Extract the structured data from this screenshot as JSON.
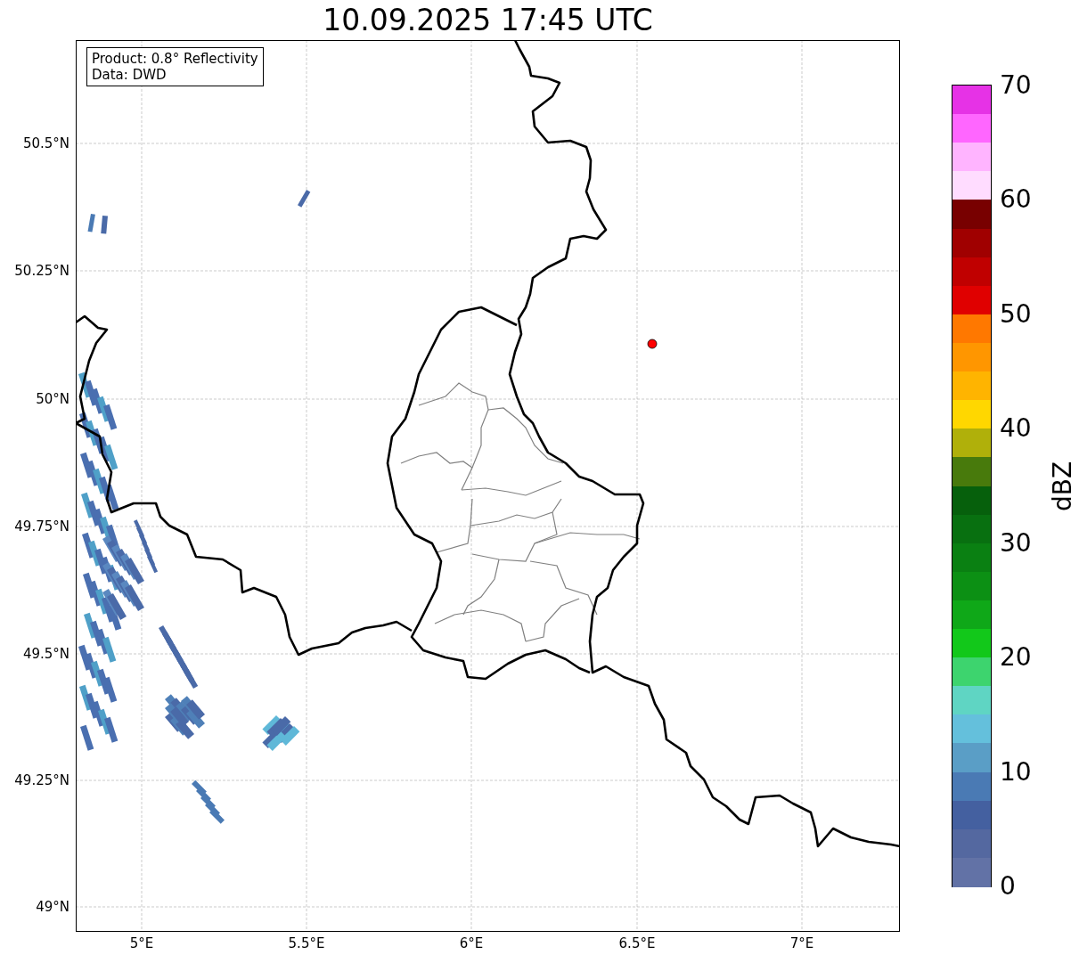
{
  "title": "10.09.2025 17:45 UTC",
  "map": {
    "info": [
      "Product: 0.8° Reflectivity",
      "Data: DWD"
    ],
    "xticks": [
      "5°E",
      "5.5°E",
      "6°E",
      "6.5°E",
      "7°E"
    ],
    "yticks": [
      "50.5°N",
      "50.25°N",
      "50°N",
      "49.75°N",
      "49.5°N",
      "49.25°N",
      "49°N"
    ]
  },
  "colorbar": {
    "label": "dBZ",
    "ticks": [
      "70",
      "60",
      "50",
      "40",
      "30",
      "20",
      "10",
      "0"
    ],
    "levels": [
      {
        "color": "#e632e6"
      },
      {
        "color": "#ff66ff"
      },
      {
        "color": "#ffb4ff"
      },
      {
        "color": "#ffdcff"
      },
      {
        "color": "#780000"
      },
      {
        "color": "#a00000"
      },
      {
        "color": "#c00000"
      },
      {
        "color": "#e00000"
      },
      {
        "color": "#ff7800"
      },
      {
        "color": "#ff9600"
      },
      {
        "color": "#ffb400"
      },
      {
        "color": "#ffd700"
      },
      {
        "color": "#b0b00a"
      },
      {
        "color": "#487a0c"
      },
      {
        "color": "#06600c"
      },
      {
        "color": "#087010"
      },
      {
        "color": "#0a8012"
      },
      {
        "color": "#0c9014"
      },
      {
        "color": "#0fa818"
      },
      {
        "color": "#12c81a"
      },
      {
        "color": "#3dd46e"
      },
      {
        "color": "#5fd5c3"
      },
      {
        "color": "#64c0dc"
      },
      {
        "color": "#5a9ec6"
      },
      {
        "color": "#4a7ab4"
      },
      {
        "color": "#4460a0"
      },
      {
        "color": "#5468a0"
      },
      {
        "color": "#6272a6"
      }
    ]
  }
}
